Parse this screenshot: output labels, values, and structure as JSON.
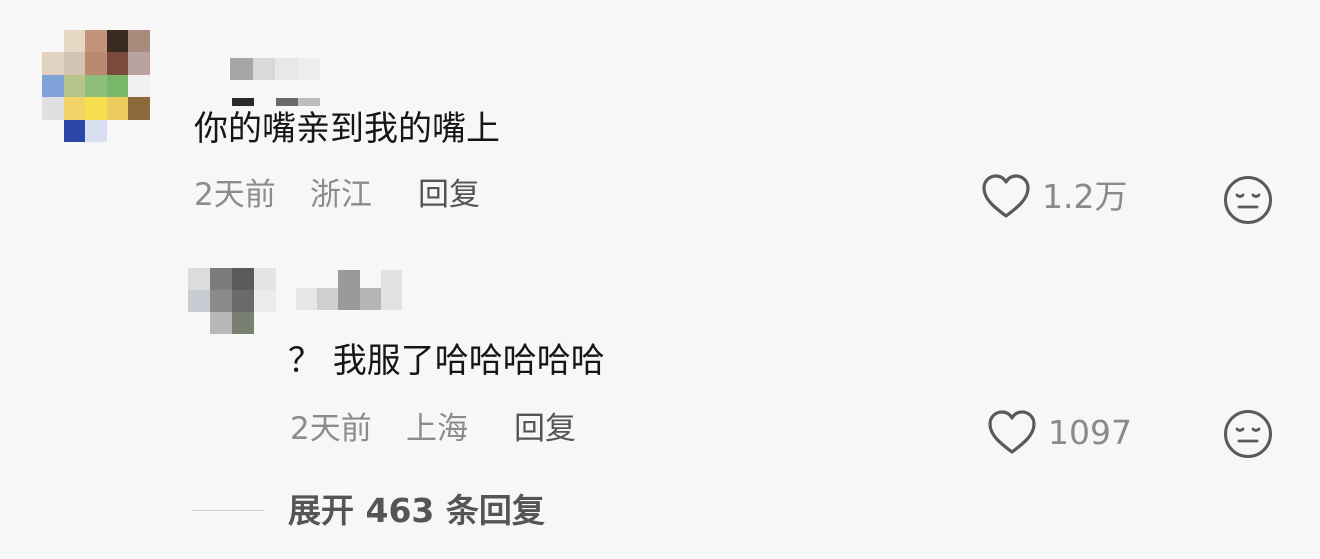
{
  "comment": {
    "text": "你的嘴亲到我的嘴上",
    "time": "2天前",
    "location": "浙江",
    "reply_label": "回复",
    "likes": "1.2万",
    "avatar_colors": [
      "#f7f7f7",
      "#e6d8c4",
      "#c2957a",
      "#3a2a22",
      "#a98a7c",
      "#e2d2c2",
      "#d2c3b2",
      "#b88b70",
      "#7a4a3a",
      "#b9a3a0",
      "#7fa3d9",
      "#b6c48a",
      "#8fbf7a",
      "#78b66a",
      "#f0f0f0",
      "#e0e0e0",
      "#f1d36a",
      "#f5e050",
      "#eacb5c",
      "#8a6a3a",
      "#f7f7f7",
      "#2b47a8",
      "#d8dff0",
      "#f7f7f7",
      "#f7f7f7"
    ],
    "name_colors": [
      "#a6a6a6",
      "#d9d9d9",
      "#e8e8e8",
      "#eeeeee"
    ]
  },
  "reply": {
    "text": "？ 我服了哈哈哈哈哈",
    "time": "2天前",
    "location": "上海",
    "reply_label": "回复",
    "likes": "1097",
    "avatar_colors": [
      "#dcdcdc",
      "#7c7c7c",
      "#5a5a5a",
      "#e4e4e4",
      "#c8ccd2",
      "#8a8a8a",
      "#6a6a6a",
      "#ececec",
      "#f7f7f7",
      "#b8b8b8",
      "#7a8070",
      "#f7f7f7"
    ],
    "name_colors": [
      "#e6e6e6",
      "#cfcfcf",
      "#9a9a9a",
      "#b4b4b4",
      "#e2e2e2"
    ]
  },
  "expand": {
    "label": "展开 463 条回复"
  }
}
